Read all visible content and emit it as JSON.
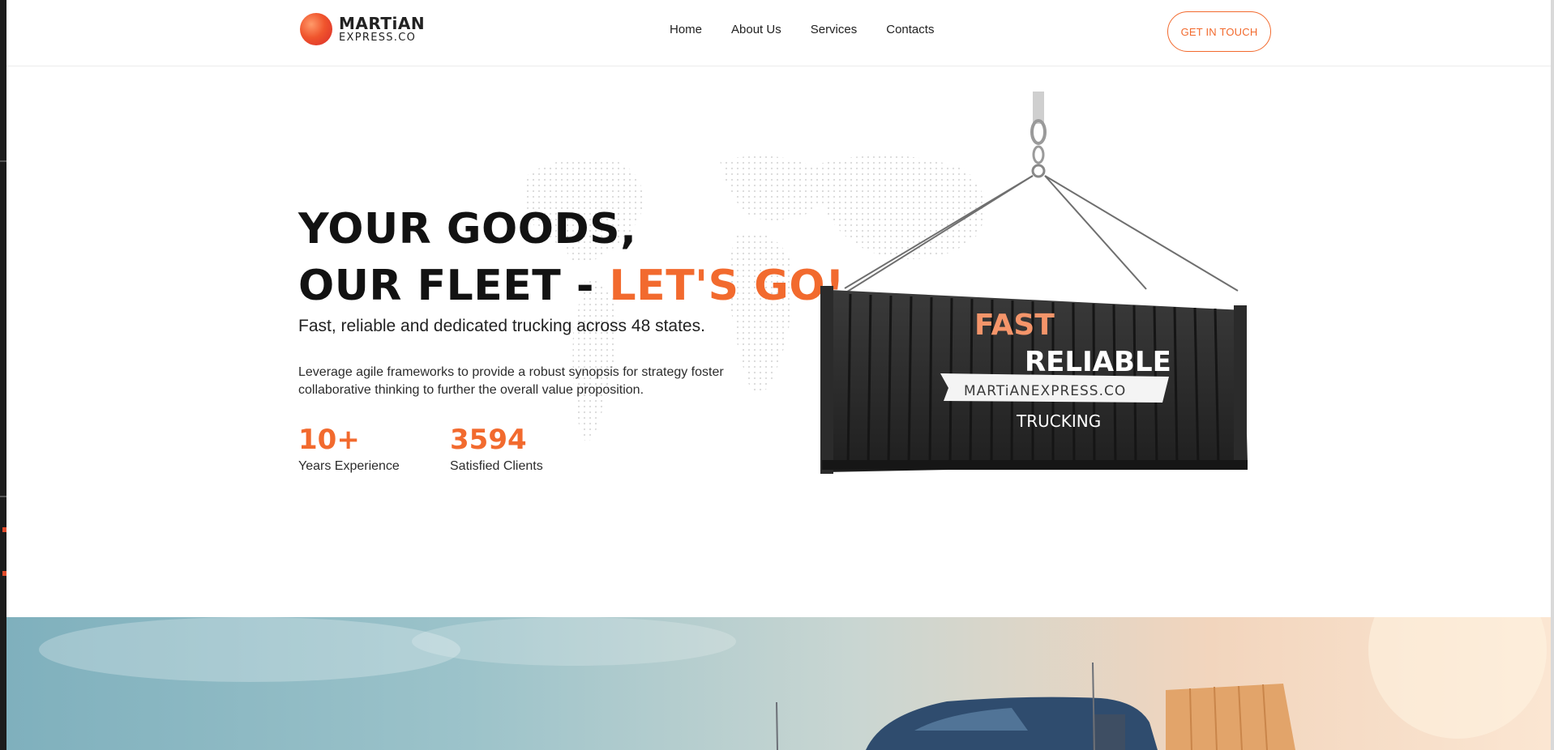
{
  "brand": {
    "name_line1": "MARTiAN",
    "name_line2": "EXPRESS.CO"
  },
  "nav": {
    "items": [
      {
        "label": "Home"
      },
      {
        "label": "About Us"
      },
      {
        "label": "Services"
      },
      {
        "label": "Contacts"
      }
    ],
    "cta_label": "GET IN TOUCH"
  },
  "hero": {
    "title_line1": "YOUR GOODS,",
    "title_line2_prefix": "OUR FLEET - ",
    "title_line2_accent": "LET'S GO!",
    "subtitle": "Fast, reliable and dedicated trucking across 48 states.",
    "description": "Leverage agile frameworks to provide a robust synopsis for strategy foster collaborative thinking to further the overall value proposition.",
    "stats": [
      {
        "value": "10+",
        "label": "Years Experience"
      },
      {
        "value": "3594",
        "label": "Satisfied Clients"
      }
    ]
  },
  "container_image": {
    "text_fast": "FAST",
    "text_reliable": "RELIABLE",
    "text_brand": "MARTiANEXPRESS.CO",
    "text_trucking": "TRUCKING"
  },
  "colors": {
    "accent": "#f26a2e",
    "text_dark": "#121212",
    "container": "#2a2a2a"
  },
  "icons": {
    "logo": "planet-logo-icon"
  }
}
